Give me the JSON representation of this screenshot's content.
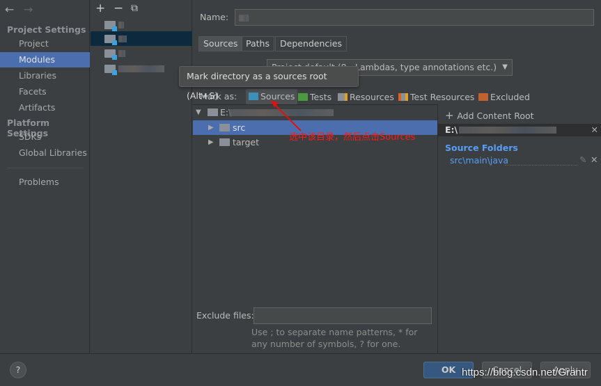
{
  "sidebar": {
    "back": "←",
    "forward": "→",
    "project_settings": "Project Settings",
    "items": [
      "Project",
      "Modules",
      "Libraries",
      "Facets",
      "Artifacts"
    ],
    "platform_settings": "Platform Settings",
    "platform_items": [
      "SDKs",
      "Global Libraries"
    ],
    "problems": "Problems"
  },
  "toolbar": {
    "add": "+",
    "remove": "−",
    "copy": "⧉"
  },
  "main": {
    "name_label": "Name:",
    "tabs": [
      "Sources",
      "Paths",
      "Dependencies"
    ],
    "language_level": "Project default (8 - Lambdas, type annotations etc.)",
    "tooltip": "Mark directory as a sources root (Alt+S)",
    "mark_as": "Mark as:",
    "marks": [
      {
        "label": "Sources",
        "color": "#3d8fb8"
      },
      {
        "label": "Tests",
        "color": "#4c9a3f"
      },
      {
        "label": "Resources",
        "color": "#8a9099"
      },
      {
        "label": "Test Resources",
        "color": "#8a9099"
      },
      {
        "label": "Excluded",
        "color": "#c0622d"
      }
    ],
    "tree": {
      "root": "E:\\",
      "children": [
        "src",
        "target"
      ]
    },
    "annotation": "选中该目录，然后点击Sources",
    "exclude_label": "Exclude files:",
    "hint": "Use ; to separate name patterns, * for any number of symbols, ? for one."
  },
  "right": {
    "add_content_root": "Add Content Root",
    "root_path": "E:\\",
    "source_folders": "Source Folders",
    "source_path": "src\\main\\java"
  },
  "footer": {
    "help": "?",
    "ok": "OK",
    "cancel": "Cancel",
    "apply": "Apply",
    "watermark": "https://blog.csdn.net/Grantr"
  }
}
